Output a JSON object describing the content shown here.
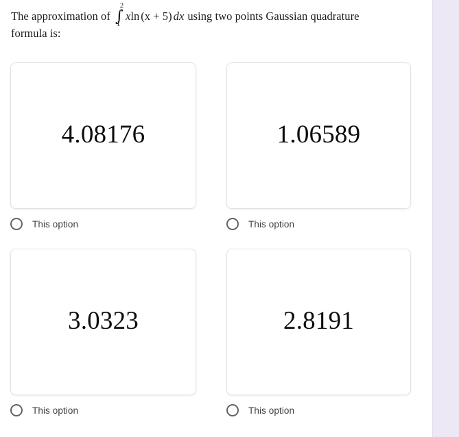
{
  "question": {
    "lead_text": "The approximation of",
    "integral": {
      "symbol": "∫",
      "lower_limit": "1",
      "upper_limit": "2",
      "integrand_var": "x",
      "integrand_fn": "ln",
      "integrand_arg": "(x + 5)",
      "differential": "dx"
    },
    "trailing_text": "using two points Gaussian quadrature",
    "second_line": "formula is:"
  },
  "options": [
    {
      "value": "4.08176",
      "choice_label": "This option",
      "radio": "radio-unselected",
      "selected": false
    },
    {
      "value": "1.06589",
      "choice_label": "This option",
      "radio": "radio-unselected",
      "selected": false
    },
    {
      "value": "3.0323",
      "choice_label": "This option",
      "radio": "radio-unselected",
      "selected": false
    },
    {
      "value": "2.8191",
      "choice_label": "This option",
      "radio": "radio-unselected",
      "selected": false
    }
  ],
  "colors": {
    "page_background": "#ffffff",
    "gutter_background": "#ece9f5",
    "card_border": "#e3e3e3",
    "question_text": "#1c1c1c",
    "option_value_text": "#0c0c0c",
    "choice_label_text": "#3c4043",
    "radio_stroke": "#5f6368"
  }
}
